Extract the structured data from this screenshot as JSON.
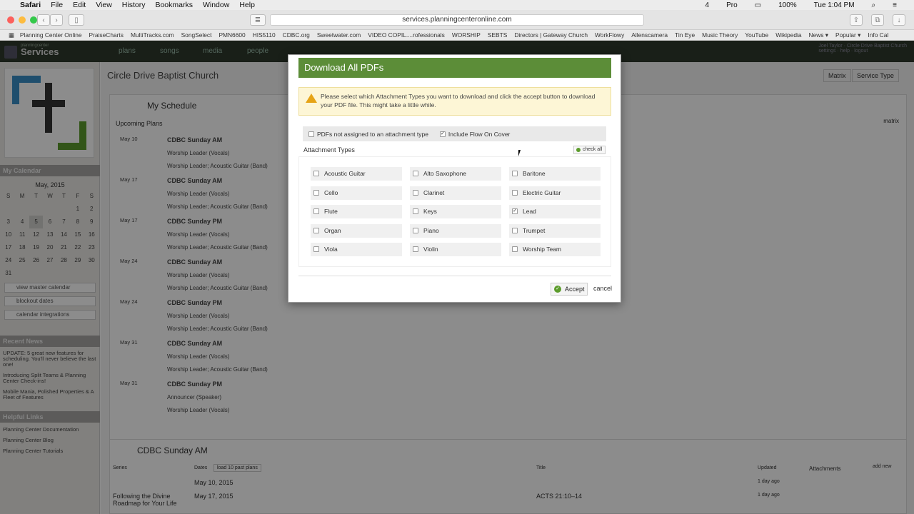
{
  "menubar": {
    "app": "Safari",
    "items": [
      "File",
      "Edit",
      "View",
      "History",
      "Bookmarks",
      "Window",
      "Help"
    ],
    "status": [
      "4",
      "Pro",
      "100%",
      "Tue 1:04 PM"
    ]
  },
  "browser": {
    "url": "services.planningcenteronline.com",
    "bookmarks": [
      "Planning Center Online",
      "PraiseCharts",
      "MultiTracks.com",
      "SongSelect",
      "PMN6600",
      "HIS5110",
      "CDBC.org",
      "Sweetwater.com",
      "VIDEO COPIL....rofessionals",
      "WORSHIP",
      "SEBTS",
      "Directors | Gateway Church",
      "WorkFlowy",
      "Allenscamera",
      "Tin Eye",
      "Music Theory",
      "YouTube",
      "Wikipedia",
      "News ▾",
      "Popular ▾",
      "Info Cal"
    ]
  },
  "app": {
    "logo_small": "planningcenter",
    "logo": "Services",
    "tabs": [
      "plans",
      "songs",
      "media",
      "people"
    ],
    "user": "Joel Taylor",
    "org": "Circle Drive Baptist Church",
    "user_links": "settings · help · logout"
  },
  "sidebar": {
    "my_calendar": "My Calendar",
    "month": "May, 2015",
    "weekdays": [
      "S",
      "M",
      "T",
      "W",
      "T",
      "F",
      "S"
    ],
    "days": [
      "",
      "",
      "",
      "",
      "",
      "1",
      "2",
      "3",
      "4",
      "5",
      "6",
      "7",
      "8",
      "9",
      "10",
      "11",
      "12",
      "13",
      "14",
      "15",
      "16",
      "17",
      "18",
      "19",
      "20",
      "21",
      "22",
      "23",
      "24",
      "25",
      "26",
      "27",
      "28",
      "29",
      "30",
      "31",
      "",
      "",
      "",
      "",
      "",
      ""
    ],
    "buttons": [
      "view master calendar",
      "blockout dates",
      "calendar integrations"
    ],
    "recent_news": "Recent News",
    "news": [
      "UPDATE: 5 great new features for scheduling. You'll never believe the last one!",
      "Introducing Split Teams & Planning Center Check-ins!",
      "Mobile Mania, Polished Properties & A Fleet of Features"
    ],
    "helpful_links": "Helpful Links",
    "links": [
      "Planning Center Documentation",
      "Planning Center Blog",
      "Planning Center Tutorials"
    ]
  },
  "main": {
    "church": "Circle Drive Baptist Church",
    "matrix": "Matrix",
    "service_type": "Service Type",
    "my_schedule": "My Schedule",
    "upcoming": "Upcoming Plans",
    "matrix_small": "matrix",
    "schedule": [
      {
        "date": "May 10",
        "title": "CDBC Sunday AM",
        "roles": [
          "Worship Leader (Vocals)",
          "Worship Leader; Acoustic Guitar (Band)"
        ]
      },
      {
        "date": "May 17",
        "title": "CDBC Sunday AM",
        "roles": [
          "Worship Leader (Vocals)",
          "Worship Leader; Acoustic Guitar (Band)"
        ]
      },
      {
        "date": "May 17",
        "title": "CDBC Sunday PM",
        "roles": [
          "Worship Leader (Vocals)",
          "Worship Leader; Acoustic Guitar (Band)"
        ]
      },
      {
        "date": "May 24",
        "title": "CDBC Sunday AM",
        "roles": [
          "Worship Leader (Vocals)",
          "Worship Leader; Acoustic Guitar (Band)"
        ]
      },
      {
        "date": "May 24",
        "title": "CDBC Sunday PM",
        "roles": [
          "Worship Leader (Vocals)",
          "Worship Leader; Acoustic Guitar (Band)"
        ]
      },
      {
        "date": "May 31",
        "title": "CDBC Sunday AM",
        "roles": [
          "Worship Leader (Vocals)",
          "Worship Leader; Acoustic Guitar (Band)"
        ]
      },
      {
        "date": "May 31",
        "title": "CDBC Sunday PM",
        "roles": [
          "Announcer (Speaker)",
          "Worship Leader (Vocals)"
        ]
      }
    ],
    "service": "CDBC Sunday AM",
    "cols": {
      "series": "Series",
      "dates": "Dates",
      "past": "load 10 past plans",
      "title": "Title",
      "updated": "Updated",
      "attachments": "Attachments",
      "add_new": "add new"
    },
    "rows": [
      {
        "series": "",
        "date": "May 10, 2015",
        "title": "",
        "updated": "1 day ago"
      },
      {
        "series": "Following the Divine Roadmap for Your Life",
        "date": "May 17, 2015",
        "title": "ACTS 21:10–14",
        "updated": "1 day ago"
      }
    ]
  },
  "modal": {
    "title": "Download All PDFs",
    "warning": "Please select which Attachment Types you want to download and click the accept button to download your PDF file. This might take a little while.",
    "opt_unassigned": "PDFs not assigned to an attachment type",
    "opt_flow": "Include Flow On Cover",
    "opt_unassigned_checked": false,
    "opt_flow_checked": true,
    "types_label": "Attachment Types",
    "check_all": "check all",
    "types": [
      {
        "label": "Acoustic Guitar",
        "checked": false
      },
      {
        "label": "Alto Saxophone",
        "checked": false
      },
      {
        "label": "Baritone",
        "checked": false
      },
      {
        "label": "Cello",
        "checked": false
      },
      {
        "label": "Clarinet",
        "checked": false
      },
      {
        "label": "Electric Guitar",
        "checked": false
      },
      {
        "label": "Flute",
        "checked": false
      },
      {
        "label": "Keys",
        "checked": false
      },
      {
        "label": "Lead",
        "checked": true
      },
      {
        "label": "Organ",
        "checked": false
      },
      {
        "label": "Piano",
        "checked": false
      },
      {
        "label": "Trumpet",
        "checked": false
      },
      {
        "label": "Viola",
        "checked": false
      },
      {
        "label": "Violin",
        "checked": false
      },
      {
        "label": "Worship Team",
        "checked": false
      }
    ],
    "accept": "Accept",
    "cancel": "cancel"
  },
  "colors": {
    "header_green": "#5c8d38",
    "warning_bg": "#fdf6d6",
    "app_header": "#2f3a2c"
  }
}
